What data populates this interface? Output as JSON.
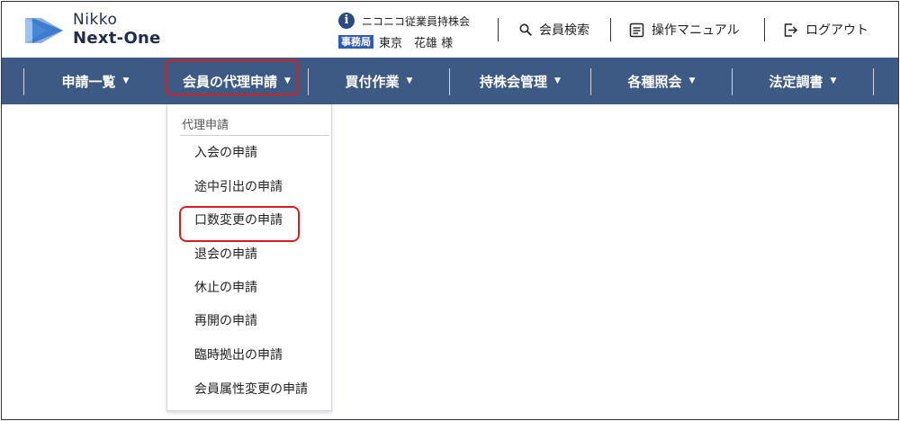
{
  "header": {
    "logo_line1": "Nikko",
    "logo_line2": "Next-One",
    "association_name": "ニコニコ従業員持株会",
    "office_tag": "事務局",
    "user_name": "東京　花雄 様",
    "links": {
      "member_search": "会員検索",
      "manual": "操作マニュアル",
      "logout": "ログアウト"
    },
    "icons": [
      "info-icon",
      "search-icon",
      "manual-icon",
      "logout-icon"
    ]
  },
  "nav": {
    "items": [
      {
        "label": "申請一覧"
      },
      {
        "label": "会員の代理申請"
      },
      {
        "label": "買付作業"
      },
      {
        "label": "持株会管理"
      },
      {
        "label": "各種照会"
      },
      {
        "label": "法定調書"
      }
    ],
    "active_index": 1,
    "bar_color": "#3d5a85"
  },
  "dropdown": {
    "header": "代理申請",
    "items": [
      {
        "label": "入会の申請"
      },
      {
        "label": "途中引出の申請"
      },
      {
        "label": "口数変更の申請"
      },
      {
        "label": "退会の申請"
      },
      {
        "label": "休止の申請"
      },
      {
        "label": "再開の申請"
      },
      {
        "label": "臨時拠出の申請"
      },
      {
        "label": "会員属性変更の申請"
      }
    ],
    "highlighted_index": 2
  },
  "colors": {
    "brand_dark": "#1f2d4d",
    "brand_blue": "#2f5bb7",
    "highlight": "#d62020"
  }
}
